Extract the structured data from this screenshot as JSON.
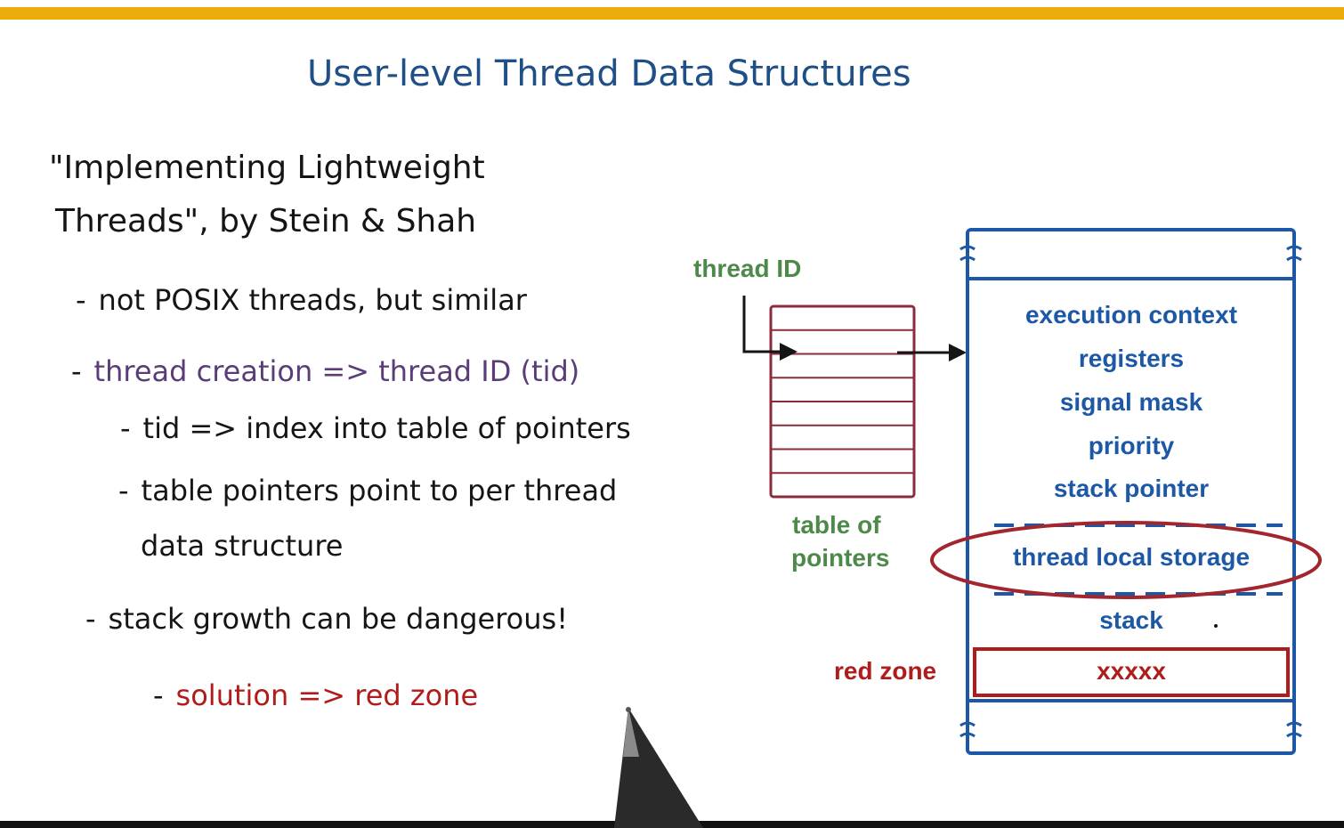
{
  "title": "User-level Thread Data Structures",
  "citation": {
    "line1": "\"Implementing Lightweight",
    "line2": "Threads\", by Stein & Shah"
  },
  "bullets": {
    "b1": "not POSIX threads, but similar",
    "b2": "thread creation => thread ID (tid)",
    "b3": "tid => index into table of pointers",
    "b4_line1": "table pointers point to per thread",
    "b4_line2": "data structure",
    "b5": "stack growth can be dangerous!",
    "b6": "solution => red zone",
    "dash": "-"
  },
  "diagram": {
    "thread_id_label": "thread ID",
    "table_label_line1": "table of",
    "table_label_line2": "pointers",
    "table_rows": 8,
    "context_fields": [
      "execution context",
      "registers",
      "signal mask",
      "priority",
      "stack pointer"
    ],
    "tls_label": "thread local storage",
    "stack_label": "stack",
    "red_zone_label": "red zone",
    "red_zone_content": "xxxxx"
  },
  "colors": {
    "accent_bar": "#ecad0b",
    "bottom_bar": "#111111",
    "title_blue": "#1e4f86",
    "ink_black": "#151515",
    "ink_purple": "#5a3d78",
    "ink_red": "#b01c1c",
    "label_green": "#4d8a4a",
    "struct_blue": "#1c58a6",
    "table_maroon": "#8b2c3c",
    "ellipse_red": "#a3262e"
  }
}
